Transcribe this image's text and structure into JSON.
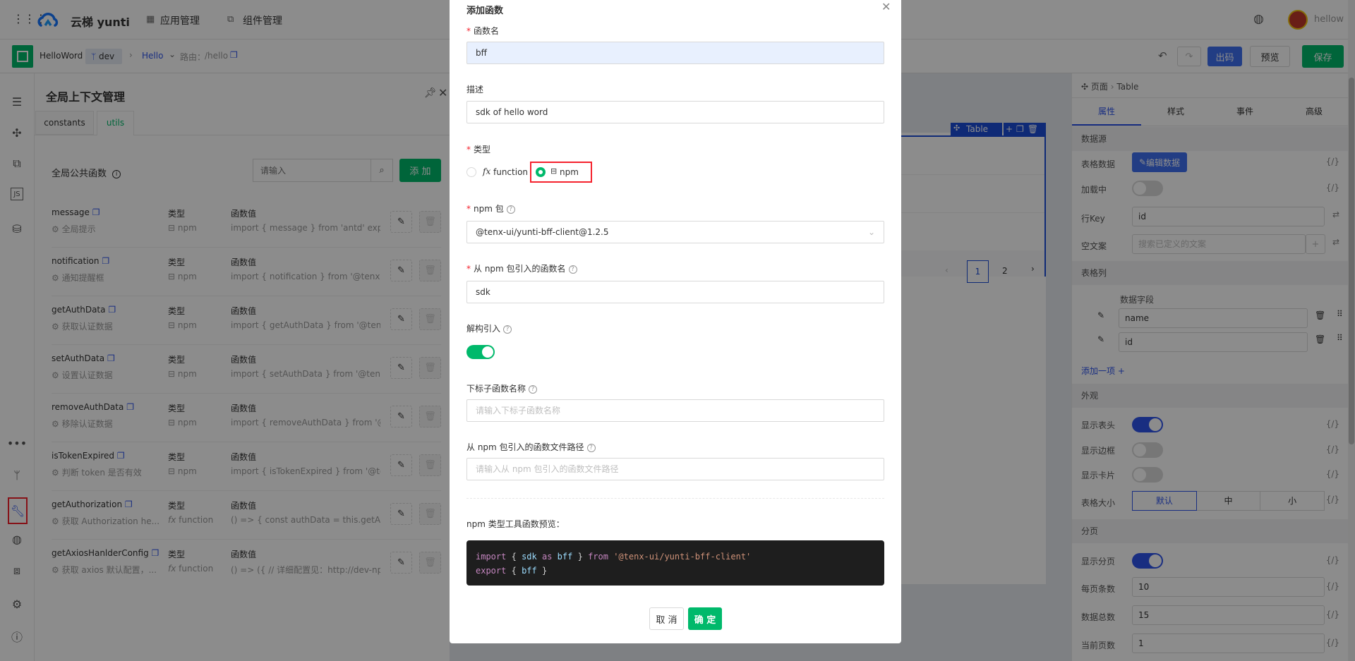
{
  "header": {
    "app_name": "云梯 yunti",
    "nav": [
      "应用管理",
      "组件管理"
    ],
    "user": "hellow"
  },
  "subbar": {
    "project": "HelloWord",
    "branch": "dev",
    "page": "Hello",
    "route_label": "路由：",
    "route": "/hello",
    "actions": {
      "export": "出码",
      "preview": "预览",
      "save": "保存"
    }
  },
  "context_panel": {
    "title": "全局上下文管理",
    "tabs": [
      "constants",
      "utils"
    ],
    "active_tab": "utils",
    "section_title": "全局公共函数",
    "search_placeholder": "请输入",
    "add_label": "添 加",
    "type_label": "类型",
    "value_label": "函数值",
    "functions": [
      {
        "name": "message",
        "desc": "全局提示",
        "type": "npm",
        "value": "import { message } from 'antd' export..."
      },
      {
        "name": "notification",
        "desc": "通知提醒框",
        "type": "npm",
        "value": "import { notification } from '@tenx-ui..."
      },
      {
        "name": "getAuthData",
        "desc": "获取认证数据",
        "type": "npm",
        "value": "import { getAuthData } from '@tenx-..."
      },
      {
        "name": "setAuthData",
        "desc": "设置认证数据",
        "type": "npm",
        "value": "import { setAuthData } from '@tenx-u..."
      },
      {
        "name": "removeAuthData",
        "desc": "移除认证数据",
        "type": "npm",
        "value": "import { removeAuthData } from '@te..."
      },
      {
        "name": "isTokenExpired",
        "desc": "判断 token 是否有效",
        "type": "npm",
        "value": "import { isTokenExpired } from '@tenx..."
      },
      {
        "name": "getAuthorization",
        "desc": "获取 Authorization he...",
        "type": "function",
        "value": "() => { const authData = this.getAuth..."
      },
      {
        "name": "getAxiosHanlderConfig",
        "desc": "获取 axios 默认配置，...",
        "type": "function",
        "value": "() => ({ // 详细配置见：http://dev-np..."
      }
    ]
  },
  "canvas": {
    "component_tag": "Table",
    "pagination": [
      "1",
      "2"
    ]
  },
  "props_panel": {
    "breadcrumb": [
      "页面",
      "Table"
    ],
    "tabs": [
      "属性",
      "样式",
      "事件",
      "高级"
    ],
    "active_tab": "属性",
    "datasource": {
      "title": "数据源",
      "table_data": "表格数据",
      "edit_data": "编辑数据",
      "loading": "加载中",
      "loading_on": false,
      "row_key": "行Key",
      "row_key_value": "id",
      "empty_text": "空文案",
      "empty_placeholder": "搜索已定义的文案"
    },
    "columns": {
      "title": "表格列",
      "field_label": "数据字段",
      "fields": [
        "name",
        "id"
      ],
      "add_item": "添加一项 +"
    },
    "appearance": {
      "title": "外观",
      "show_header": "显示表头",
      "show_header_on": true,
      "show_border": "显示边框",
      "show_border_on": false,
      "show_card": "显示卡片",
      "show_card_on": false,
      "size": "表格大小",
      "size_options": [
        "默认",
        "中",
        "小"
      ],
      "size_selected": "默认"
    },
    "pagination": {
      "title": "分页",
      "show": "显示分页",
      "show_on": true,
      "page_size": "每页条数",
      "page_size_value": "10",
      "total": "数据总数",
      "total_value": "15",
      "current": "当前页数",
      "current_value": "1"
    },
    "code_icon": "{/}"
  },
  "modal": {
    "title": "添加函数",
    "name_label": "函数名",
    "name_value": "bff",
    "desc_label": "描述",
    "desc_value": "sdk of hello word",
    "type_label": "类型",
    "type_options": [
      "function",
      "npm"
    ],
    "type_selected": "npm",
    "npm_label": "npm 包",
    "npm_value": "@tenx-ui/yunti-bff-client@1.2.5",
    "import_name_label": "从 npm 包引入的函数名",
    "import_name_value": "sdk",
    "destructure_label": "解构引入",
    "destructure_on": true,
    "sub_name_label": "下标子函数名称",
    "sub_name_placeholder": "请输入下标子函数名称",
    "path_label": "从 npm 包引入的函数文件路径",
    "path_placeholder": "请输入从 npm 包引入的函数文件路径",
    "preview_label": "npm 类型工具函数预览：",
    "code": {
      "line1": {
        "k1": "import",
        "b1": "{",
        "id1": "sdk",
        "k2": "as",
        "id2": "bff",
        "b2": "}",
        "k3": "from",
        "str": "'@tenx-ui/yunti-bff-client'"
      },
      "line2": {
        "k1": "export",
        "b1": "{",
        "id1": "bff",
        "b2": "}"
      }
    },
    "cancel": "取 消",
    "ok": "确 定"
  },
  "colors": {
    "primary_green": "#00b96b",
    "brand_blue": "#2f54eb",
    "highlight_red": "#f5222d"
  }
}
